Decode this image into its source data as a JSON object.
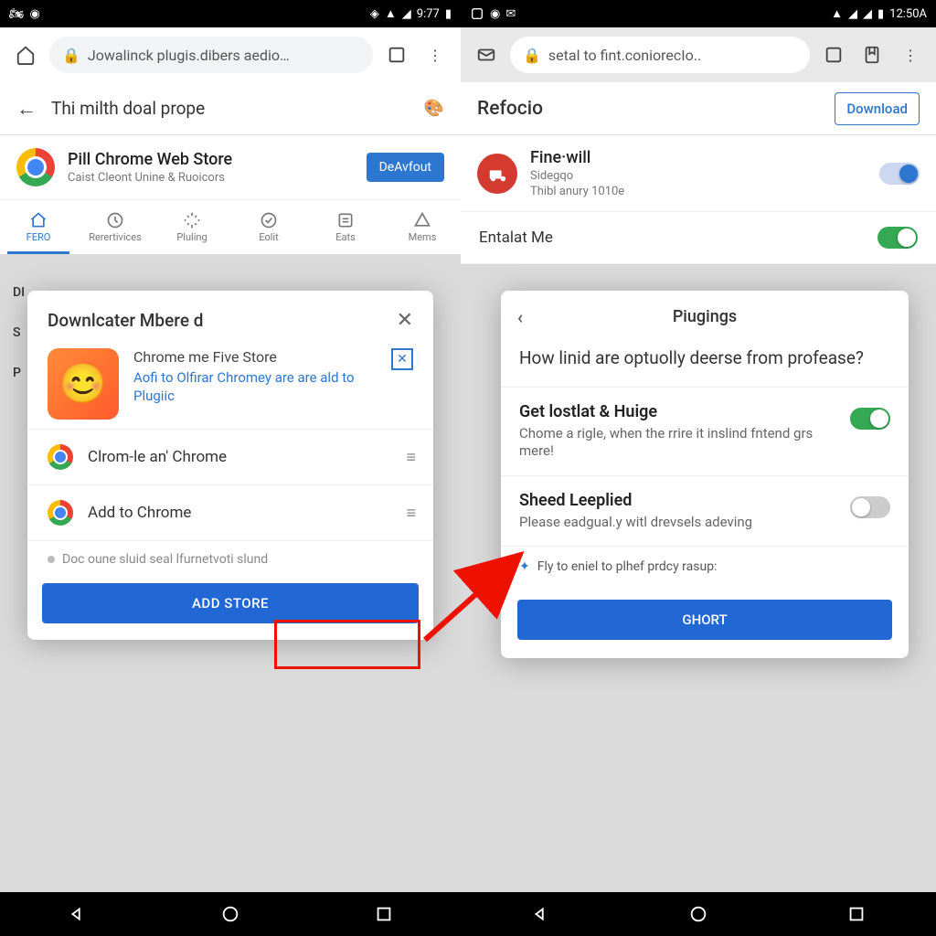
{
  "left": {
    "status": {
      "time": "9:77"
    },
    "omnibox": "Jowalinck plugis.dibers aedio…",
    "page_title": "Thi milth doal prope",
    "store": {
      "title": "Pill Chrome Web Store",
      "sub": "Caist Cleont Unine & Ruoicors",
      "btn": "DeAvfout"
    },
    "tabs": [
      "FERO",
      "Rerertivices",
      "Pluling",
      "Eolit",
      "Eats",
      "Mems"
    ],
    "letters": [
      "DI",
      "S",
      "P"
    ],
    "sheet": {
      "title": "Downlcater Mbere d",
      "line1": "Chrome me Five Store",
      "line2": "Aofi to Olfirar Chromey are are ald to Plugiic",
      "opt1": "Clrom-le an' Chrome",
      "opt2": "Add to Chrome",
      "note": "Doc oune sluid seal lfurnetvoti slund",
      "button": "ADD STORE"
    }
  },
  "right": {
    "status": {
      "time": "12:50A"
    },
    "omnibox": "setal to fint.coniorecIo..",
    "header": {
      "title": "Refocio",
      "btn": "Download"
    },
    "app": {
      "title": "Fine·will",
      "sub1": "Sidegqo",
      "sub2": "Thibl anury 1010e"
    },
    "entalat": "Entalat Me",
    "sheet": {
      "title": "Piugings",
      "question": "How linid are optuolly deerse from profease?",
      "opt1_t": "Get lostlat & Huige",
      "opt1_s": "Chome a rigle, when the rrire it inslind fntend grs mere!",
      "opt2_t": "Sheed Leeplied",
      "opt2_s": "Please eadgual.y witl drevsels adeving",
      "note": "Fly to eniel to plhef prdcy rasup:",
      "button": "GHORT"
    }
  }
}
